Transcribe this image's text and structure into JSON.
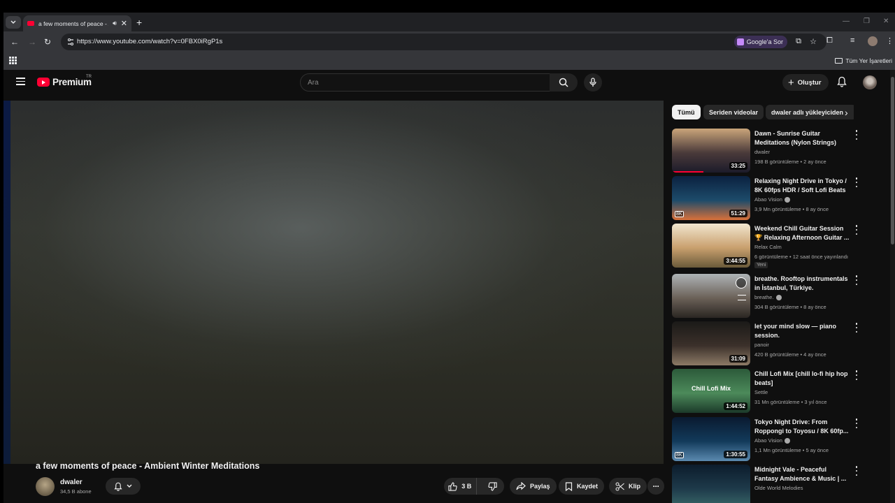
{
  "browser": {
    "tab_title": "a few moments of peace - A",
    "url": "https://www.youtube.com/watch?v=0FBX0iRgP1s",
    "ask_google": "Google'a Sor",
    "all_bookmarks": "Tüm Yer İşaretleri"
  },
  "youtube": {
    "logo_text": "Premium",
    "country": "TR",
    "search_placeholder": "Ara",
    "create_label": "Oluştur"
  },
  "video": {
    "title": "a few moments of peace - Ambient Winter Meditations",
    "channel": "dwaler",
    "subscribers": "34,5 B abone",
    "likes": "3 B",
    "share": "Paylaş",
    "save": "Kaydet",
    "clip": "Klip"
  },
  "chips": [
    "Tümü",
    "Seriden videolar",
    "dwaler adlı yükleyiciden"
  ],
  "recommendations": [
    {
      "title": "Dawn - Sunrise Guitar Meditations (Nylon Strings)",
      "channel": "dwaler",
      "verified": false,
      "meta": "198 B görüntüleme • 2 ay önce",
      "duration": "33:25",
      "badge": "",
      "new": "",
      "colors": [
        "#caa57a",
        "#4a3a3a",
        "#1c1b2a"
      ]
    },
    {
      "title": "Relaxing Night Drive in Tokyo / 8K 60fps HDR / Soft Lofi Beats",
      "channel": "Abao Vision",
      "verified": true,
      "meta": "3,9 Mn görüntüleme • 8 ay önce",
      "duration": "51:29",
      "badge": "8K",
      "new": "",
      "colors": [
        "#0b2140",
        "#1d4b6a",
        "#d8703a"
      ]
    },
    {
      "title": "Weekend Chill Guitar Session 🏆 Relaxing Afternoon Guitar ...",
      "channel": "Relax Calm",
      "verified": false,
      "meta": "6 görüntüleme • 12 saat önce yayınlandı",
      "duration": "3:44:55",
      "badge": "",
      "new": "Yeni",
      "colors": [
        "#f1e6cf",
        "#c9a06e",
        "#6a5a3a"
      ]
    },
    {
      "title": "breathe. Rooftop instrumentals in İstanbul, Türkiye.",
      "channel": "breathe.",
      "verified": true,
      "meta": "304 B görüntüleme • 8 ay önce",
      "duration": "",
      "badge": "",
      "new": "",
      "colors": [
        "#aeb3b6",
        "#6b6158",
        "#2a2622"
      ]
    },
    {
      "title": "let your mind slow — piano session.",
      "channel": "panoir",
      "verified": false,
      "meta": "420 B görüntüleme • 4 ay önce",
      "duration": "31:09",
      "badge": "",
      "new": "",
      "colors": [
        "#1b1a18",
        "#3b302a",
        "#8c7a66"
      ]
    },
    {
      "title": "Chill Lofi Mix [chill lo-fi hip hop beats]",
      "channel": "Settle",
      "verified": false,
      "meta": "31 Mn görüntüleme • 3 yıl önce",
      "duration": "1:44:52",
      "badge": "",
      "new": "",
      "colors": [
        "#2c5a3a",
        "#4c8a5a",
        "#1c3a2a"
      ],
      "thumb_text": "Chill Lofi Mix"
    },
    {
      "title": "Tokyo Night Drive: From Roppongi to Toyosu / 8K 60fp...",
      "channel": "Abao Vision",
      "verified": true,
      "meta": "1,1 Mn görüntüleme • 5 ay önce",
      "duration": "1:30:55",
      "badge": "8K",
      "new": "",
      "colors": [
        "#0a1a30",
        "#123a5a",
        "#5b8ab0"
      ]
    },
    {
      "title": "Midnight Vale - Peaceful Fantasy Ambience & Music | ...",
      "channel": "Olde World Melodies",
      "verified": false,
      "meta": "",
      "duration": "",
      "badge": "",
      "new": "",
      "colors": [
        "#0c1c2c",
        "#1e3a4a",
        "#3a6a6a"
      ]
    }
  ]
}
